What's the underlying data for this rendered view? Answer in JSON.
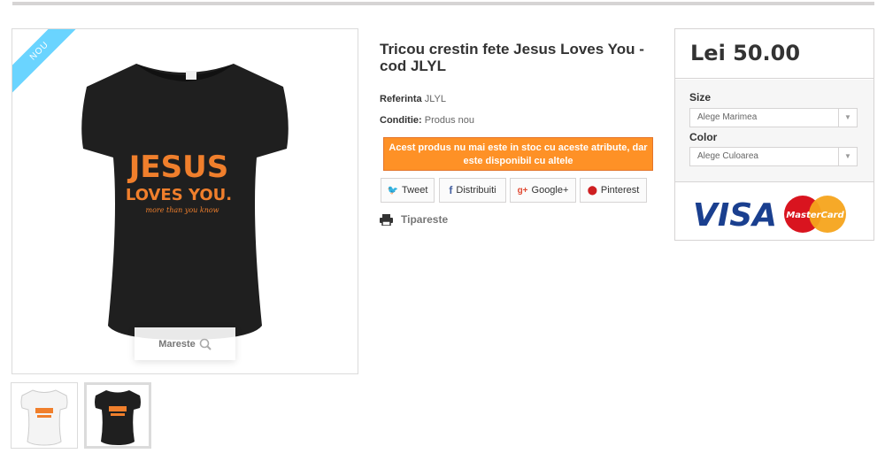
{
  "product": {
    "title": "Tricou crestin fete Jesus Loves You - cod JLYL",
    "badge": "Nou",
    "zoom_label": "Mareste",
    "reference_label": "Referinta",
    "reference_value": "JLYL",
    "condition_label": "Conditie:",
    "condition_value": "Produs nou",
    "stock_alert": "Acest produs nu mai este in stoc cu aceste atribute, dar este disponibil cu altele",
    "print_label": "Tipareste",
    "shirt_text": {
      "line1": "JESUS",
      "line2": "LOVES YOU.",
      "line3": "more than you know"
    }
  },
  "share": {
    "tweet": "Tweet",
    "facebook": "Distribuiti",
    "google": "Google+",
    "pinterest": "Pinterest"
  },
  "buy_box": {
    "price": "Lei 50.00",
    "size_label": "Size",
    "size_selected": "Alege Marimea",
    "color_label": "Color",
    "color_selected": "Alege Culoarea",
    "card_visa": "VISA",
    "card_mastercard": "MasterCard"
  },
  "colors": {
    "accent_orange": "#fe9126",
    "badge_blue": "#6ad4ff",
    "shirt_print": "#f07f2c"
  }
}
